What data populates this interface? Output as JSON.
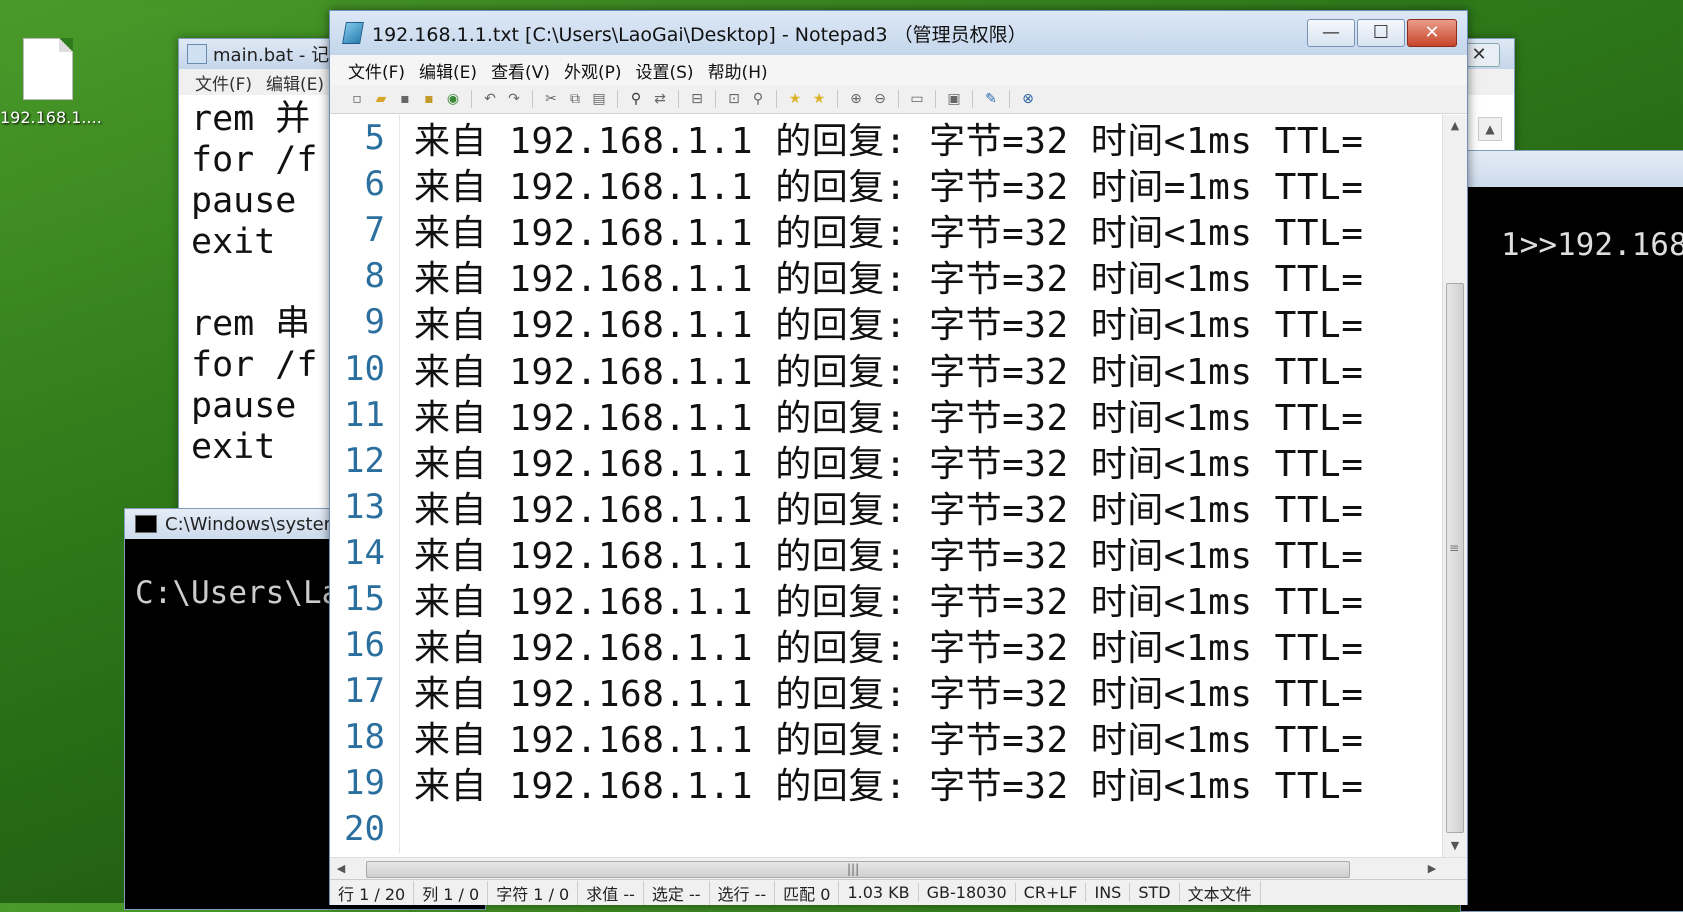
{
  "desktop": {
    "icon_label": "192.168.1...."
  },
  "back_notepad": {
    "title": "main.bat - 记",
    "menu": [
      "文件(F)",
      "编辑(E)"
    ],
    "lines": [
      "rem 并",
      "for /f",
      "pause",
      "exit",
      "",
      "rem 串",
      "for /f",
      "pause",
      "exit"
    ]
  },
  "cmd_left": {
    "title": "C:\\Windows\\system",
    "text": "C:\\Users\\La"
  },
  "cmd_right": {
    "text": "1>>192.168"
  },
  "notepad3": {
    "title": "192.168.1.1.txt [C:\\Users\\LaoGai\\Desktop] - Notepad3 （管理员权限）",
    "buttons": {
      "minimize": "—",
      "maximize": "☐",
      "close": "✕"
    },
    "menu": [
      "文件(F)",
      "编辑(E)",
      "查看(V)",
      "外观(P)",
      "设置(S)",
      "帮助(H)"
    ],
    "lines": [
      {
        "n": "5",
        "text": "来自 192.168.1.1 的回复: 字节=32 时间<1ms TTL="
      },
      {
        "n": "6",
        "text": "来自 192.168.1.1 的回复: 字节=32 时间=1ms TTL="
      },
      {
        "n": "7",
        "text": "来自 192.168.1.1 的回复: 字节=32 时间<1ms TTL="
      },
      {
        "n": "8",
        "text": "来自 192.168.1.1 的回复: 字节=32 时间<1ms TTL="
      },
      {
        "n": "9",
        "text": "来自 192.168.1.1 的回复: 字节=32 时间<1ms TTL="
      },
      {
        "n": "10",
        "text": "来自 192.168.1.1 的回复: 字节=32 时间<1ms TTL="
      },
      {
        "n": "11",
        "text": "来自 192.168.1.1 的回复: 字节=32 时间<1ms TTL="
      },
      {
        "n": "12",
        "text": "来自 192.168.1.1 的回复: 字节=32 时间<1ms TTL="
      },
      {
        "n": "13",
        "text": "来自 192.168.1.1 的回复: 字节=32 时间<1ms TTL="
      },
      {
        "n": "14",
        "text": "来自 192.168.1.1 的回复: 字节=32 时间<1ms TTL="
      },
      {
        "n": "15",
        "text": "来自 192.168.1.1 的回复: 字节=32 时间<1ms TTL="
      },
      {
        "n": "16",
        "text": "来自 192.168.1.1 的回复: 字节=32 时间<1ms TTL="
      },
      {
        "n": "17",
        "text": "来自 192.168.1.1 的回复: 字节=32 时间<1ms TTL="
      },
      {
        "n": "18",
        "text": "来自 192.168.1.1 的回复: 字节=32 时间<1ms TTL="
      },
      {
        "n": "19",
        "text": "来自 192.168.1.1 的回复: 字节=32 时间<1ms TTL="
      },
      {
        "n": "20",
        "text": ""
      }
    ],
    "status": {
      "row": "行 1 / 20",
      "col": "列 1 / 0",
      "chars": "字符 1 / 0",
      "sum": "求值 --",
      "sel": "选定 --",
      "sel_lines": "选行 --",
      "match": "匹配 0",
      "size": "1.03 KB",
      "encoding": "GB-18030",
      "eol": "CR+LF",
      "ins": "INS",
      "std": "STD",
      "type": "文本文件"
    }
  }
}
